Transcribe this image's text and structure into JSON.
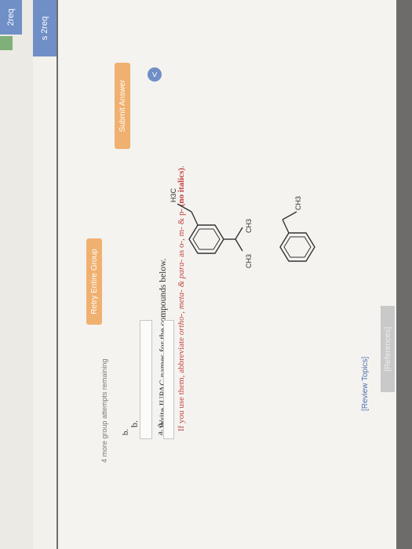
{
  "tabs": {
    "active_top": "2req",
    "sidebar_item": "2req",
    "sidebar_prefix": "s"
  },
  "links": {
    "review_topics": "[Review Topics]",
    "references": "[References]"
  },
  "question": {
    "instruction": "Write IUPAC names for the compounds below.",
    "note_prefix": "If you use them, abbreviate ",
    "note_terms": "ortho-, meta- & para-",
    "note_middle": " as o-, m- & p- ",
    "note_emph": "(no italics)",
    "note_end": "."
  },
  "compounds": {
    "a_label": "a.",
    "b_label": "b.",
    "a_ch3": "CH3",
    "b_h3c": "H3C",
    "b_ch3_top": "CH3",
    "b_ch3_bottom": "CH3"
  },
  "answers": {
    "a_label": "a.",
    "b_label": "b."
  },
  "buttons": {
    "submit": "Submit Answer",
    "retry": "Retry Entire Group"
  },
  "status": {
    "attempts": "4 more group attempts remaining"
  },
  "icons": {
    "back": "back-chevron-icon"
  }
}
